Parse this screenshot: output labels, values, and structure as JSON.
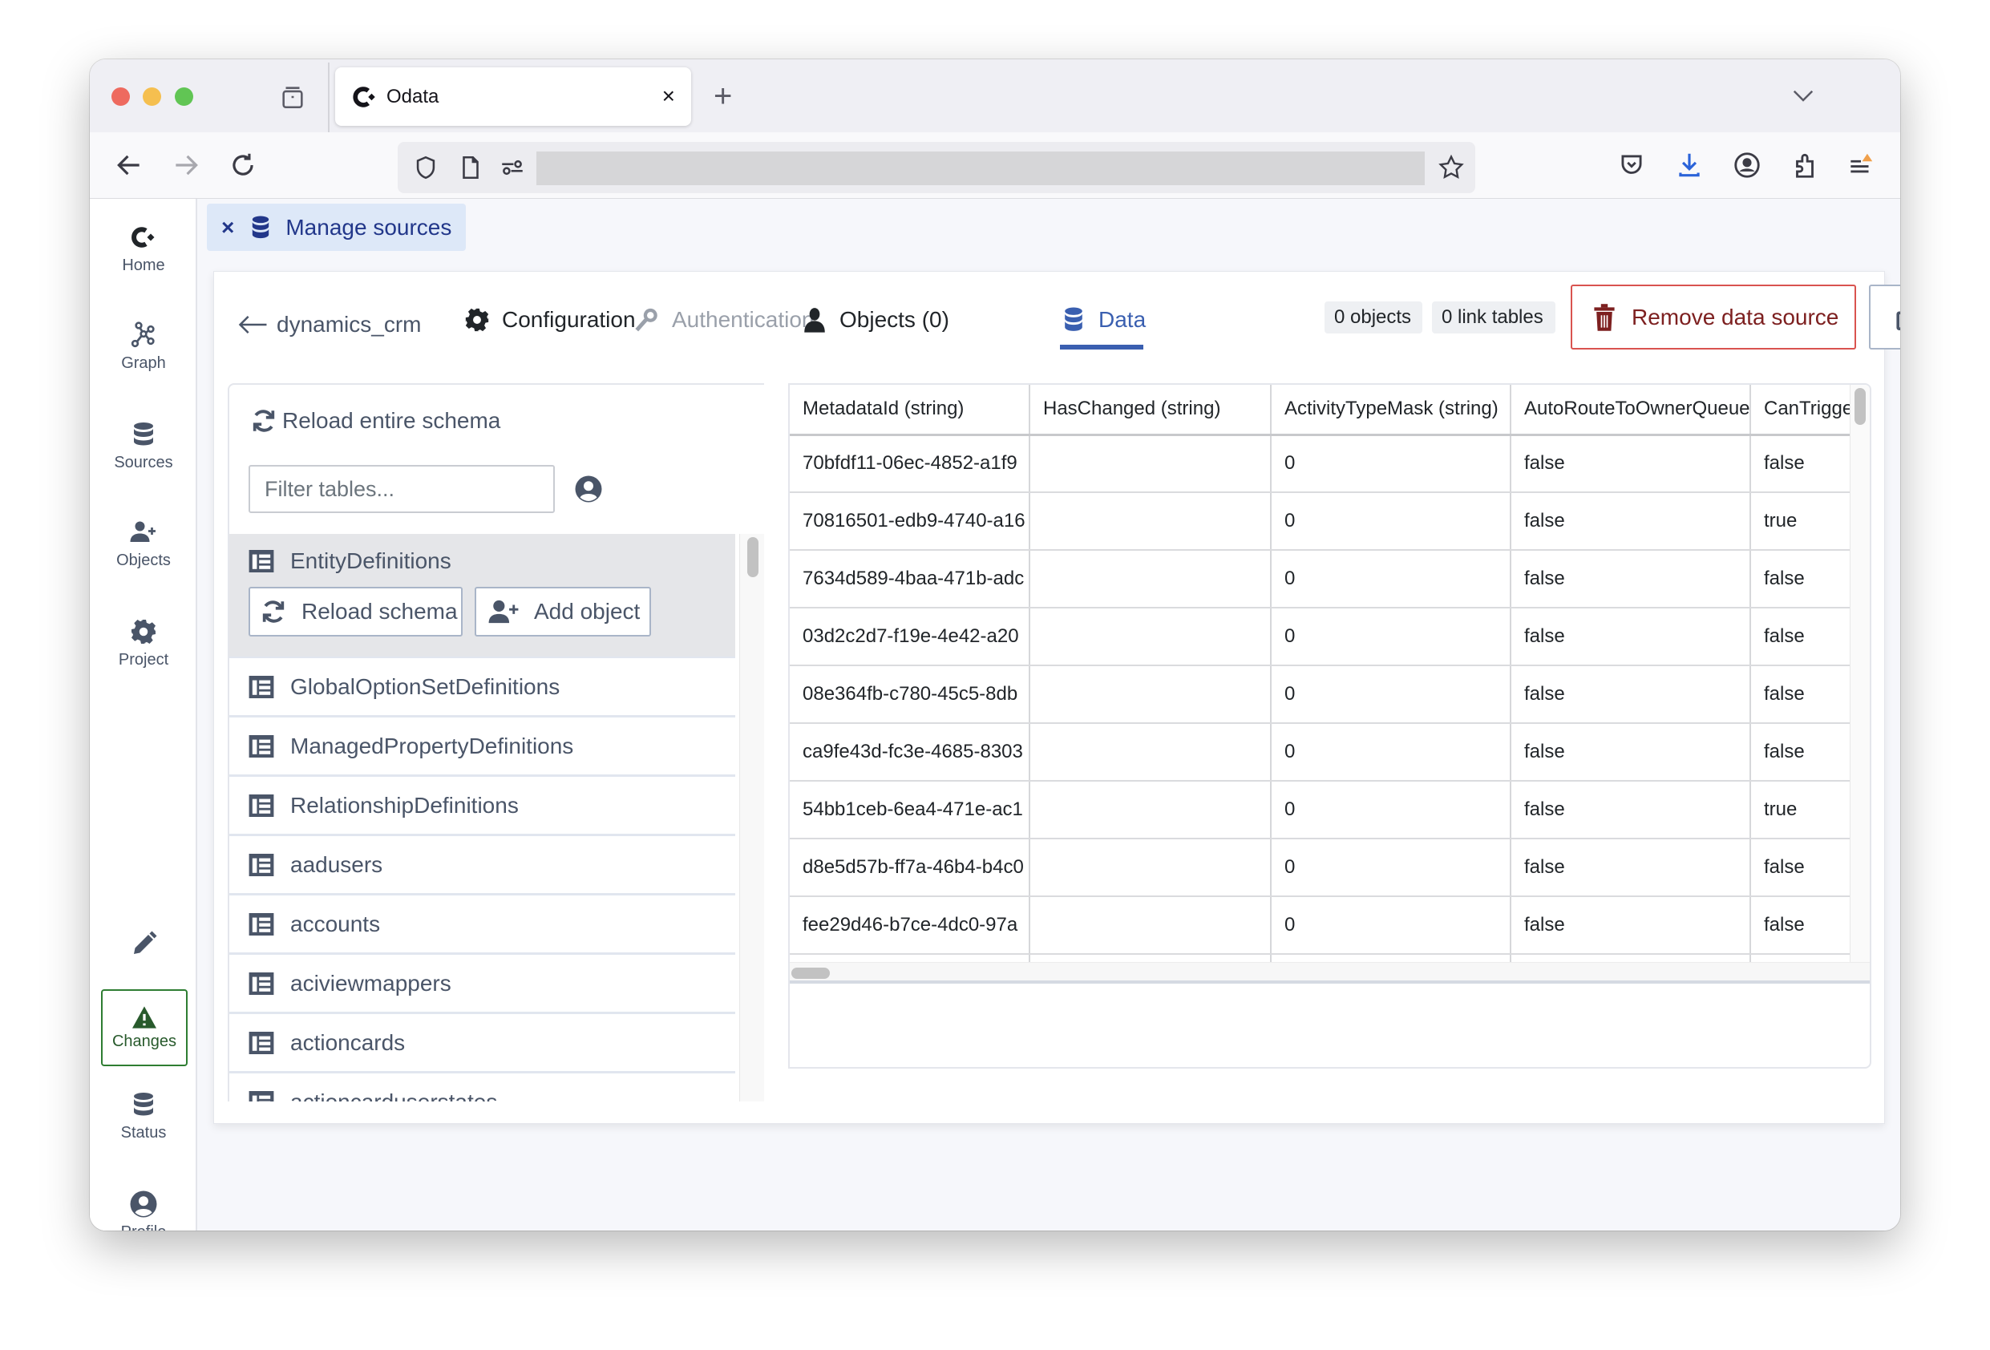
{
  "browser": {
    "tab_title": "Odata",
    "tab_close": "×",
    "new_tab": "+",
    "url": ""
  },
  "sidebar": {
    "items": [
      {
        "label": "Home",
        "icon": "logo-icon"
      },
      {
        "label": "Graph",
        "icon": "graph-icon"
      },
      {
        "label": "Sources",
        "icon": "database-icon"
      },
      {
        "label": "Objects",
        "icon": "user-plus-icon"
      },
      {
        "label": "Project",
        "icon": "gear-icon"
      }
    ],
    "edit_icon": "pencil-icon",
    "changes": {
      "label": "Changes",
      "icon": "warning-icon",
      "color": "#2e7d32"
    },
    "bottom_items": [
      {
        "label": "Status",
        "icon": "database-icon"
      },
      {
        "label": "Profile",
        "icon": "user-circle-icon"
      }
    ]
  },
  "chip": {
    "close": "×",
    "label": "Manage sources",
    "color": "#22378a",
    "background": "#dde8f8"
  },
  "header": {
    "back_label": "dynamics_crm",
    "tabs": [
      {
        "label": "Configuration",
        "icon": "gear-icon",
        "state": "normal"
      },
      {
        "label": "Authentication",
        "icon": "key-icon",
        "state": "disabled"
      },
      {
        "label": "Objects (0)",
        "icon": "user-icon",
        "state": "normal"
      },
      {
        "label": "Data",
        "icon": "database-icon",
        "state": "active"
      }
    ],
    "badges": [
      "0 objects",
      "0 link tables"
    ],
    "remove_label": "Remove data source",
    "accent_color": "#3a5fb0",
    "danger_color": "#d9534f"
  },
  "left_panel": {
    "reload_all_label": "Reload entire schema",
    "filter_placeholder": "Filter tables...",
    "filter_value": "",
    "selected": {
      "name": "EntityDefinitions",
      "reload_label": "Reload schema",
      "add_label": "Add object"
    },
    "tables": [
      "GlobalOptionSetDefinitions",
      "ManagedPropertyDefinitions",
      "RelationshipDefinitions",
      "aadusers",
      "accounts",
      "aciviewmappers",
      "actioncards",
      "actioncarduserstates"
    ]
  },
  "data_table": {
    "columns": [
      "MetadataId (string)",
      "HasChanged (string)",
      "ActivityTypeMask (string)",
      "AutoRouteToOwnerQueue",
      "CanTrigge"
    ],
    "rows": [
      [
        "70bfdf11-06ec-4852-a1f9",
        "",
        "0",
        "false",
        "false"
      ],
      [
        "70816501-edb9-4740-a16",
        "",
        "0",
        "false",
        "true"
      ],
      [
        "7634d589-4baa-471b-adc",
        "",
        "0",
        "false",
        "false"
      ],
      [
        "03d2c2d7-f19e-4e42-a20",
        "",
        "0",
        "false",
        "false"
      ],
      [
        "08e364fb-c780-45c5-8db",
        "",
        "0",
        "false",
        "false"
      ],
      [
        "ca9fe43d-fc3e-4685-8303",
        "",
        "0",
        "false",
        "false"
      ],
      [
        "54bb1ceb-6ea4-471e-ac1",
        "",
        "0",
        "false",
        "true"
      ],
      [
        "d8e5d57b-ff7a-46b4-b4c0",
        "",
        "0",
        "false",
        "false"
      ],
      [
        "fee29d46-b7ce-4dc0-97a",
        "",
        "0",
        "false",
        "false"
      ],
      [
        "",
        "",
        "",
        "",
        ""
      ]
    ]
  }
}
